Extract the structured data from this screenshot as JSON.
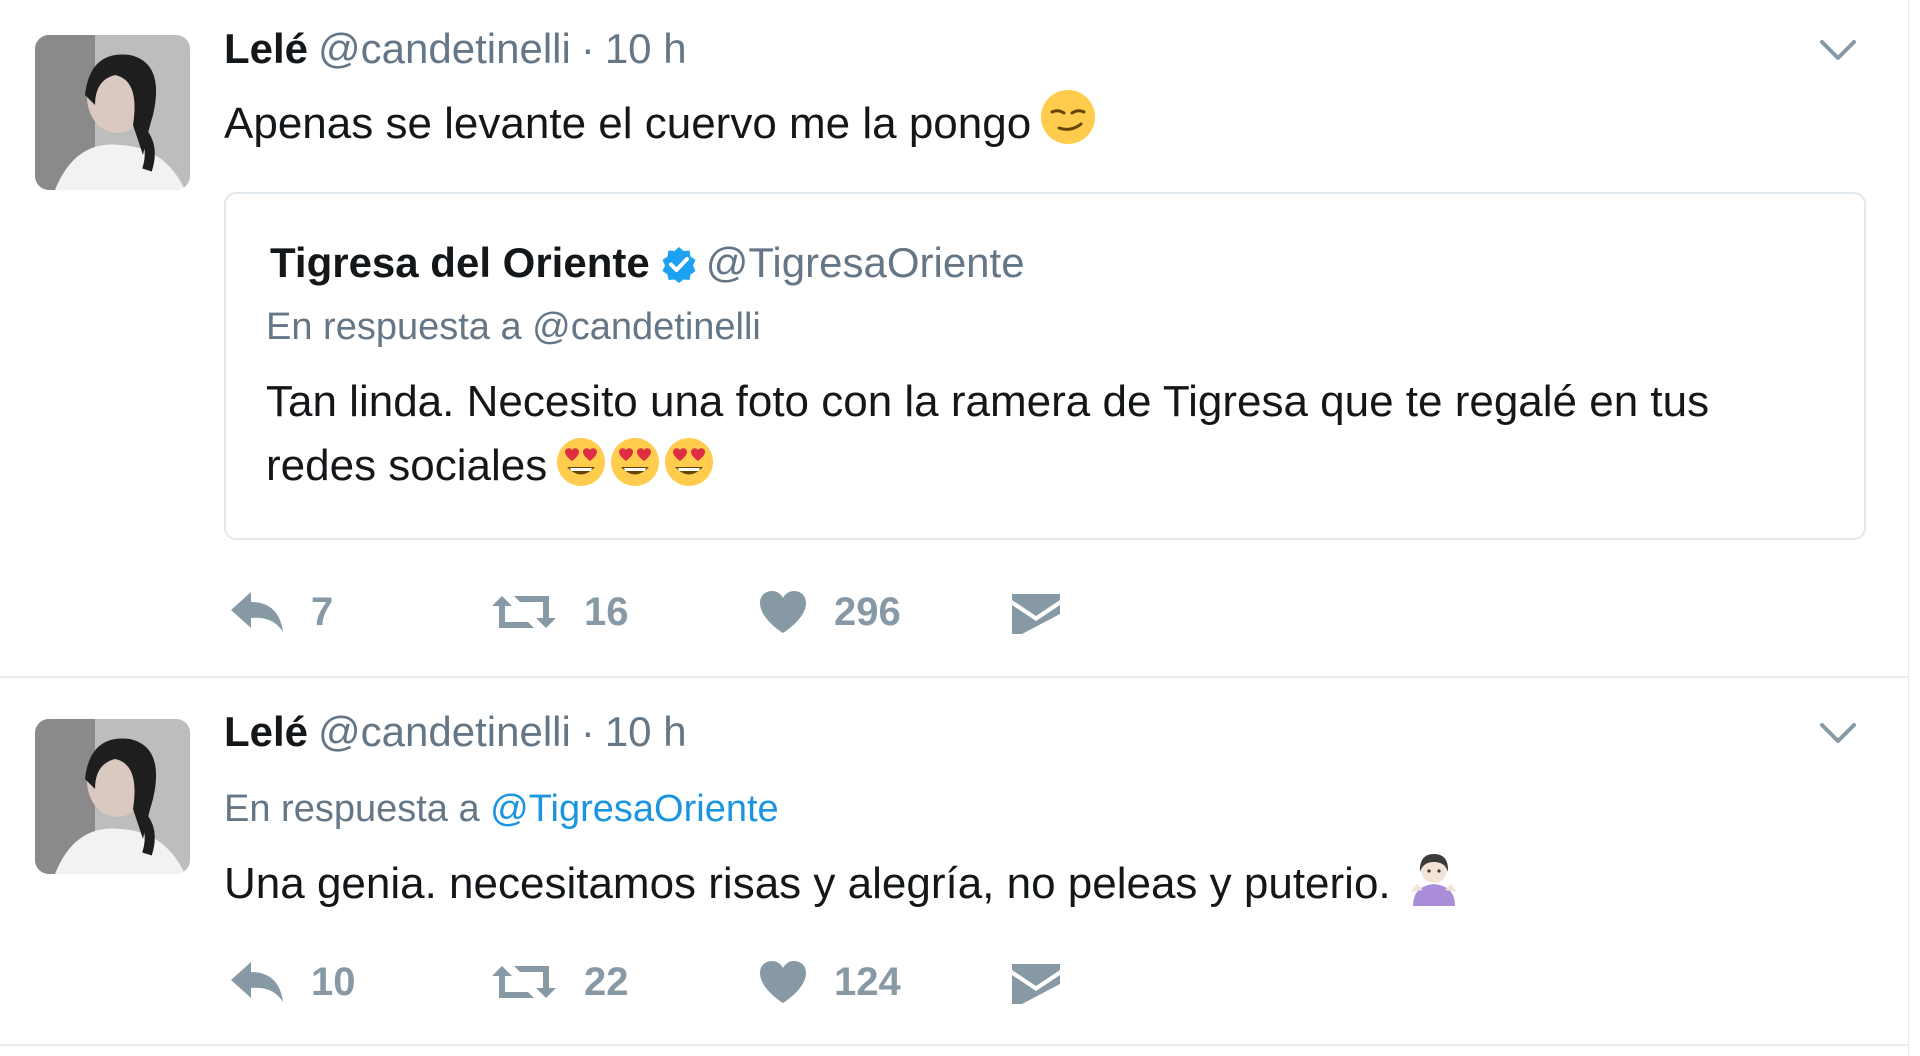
{
  "tweets": [
    {
      "author_name": "Lelé",
      "author_handle": "@candetinelli",
      "separator": "·",
      "time": "10 h",
      "text": "Apenas se levante el cuervo me la pongo",
      "text_emoji": "smirking-face-emoji",
      "quoted": {
        "author_name": "Tigresa del Oriente",
        "author_handle": "@TigresaOriente",
        "verified_icon": "verified-badge-icon",
        "reply_prefix": "En respuesta a",
        "reply_to": "@candetinelli",
        "text_line1": "Tan linda. Necesito una foto con la ramera de Tigresa que te regalé en tus",
        "text_line2": "redes sociales",
        "emojis": [
          "heart-eyes-emoji",
          "heart-eyes-emoji",
          "heart-eyes-emoji"
        ]
      },
      "actions": {
        "replies": "7",
        "retweets": "16",
        "likes": "296"
      }
    },
    {
      "author_name": "Lelé",
      "author_handle": "@candetinelli",
      "separator": "·",
      "time": "10 h",
      "reply_prefix": "En respuesta a",
      "reply_to": "@TigresaOriente",
      "text": "Una genia. necesitamos risas y alegría, no peleas y puterio.",
      "text_emoji": "person-shrugging-emoji",
      "actions": {
        "replies": "10",
        "retweets": "22",
        "likes": "124"
      }
    }
  ],
  "colors": {
    "text": "#14171a",
    "secondary": "#657786",
    "action_gray": "#8899a6",
    "link": "#1b95e0",
    "border": "#e6ecf0",
    "verified": "#1da1f2"
  }
}
